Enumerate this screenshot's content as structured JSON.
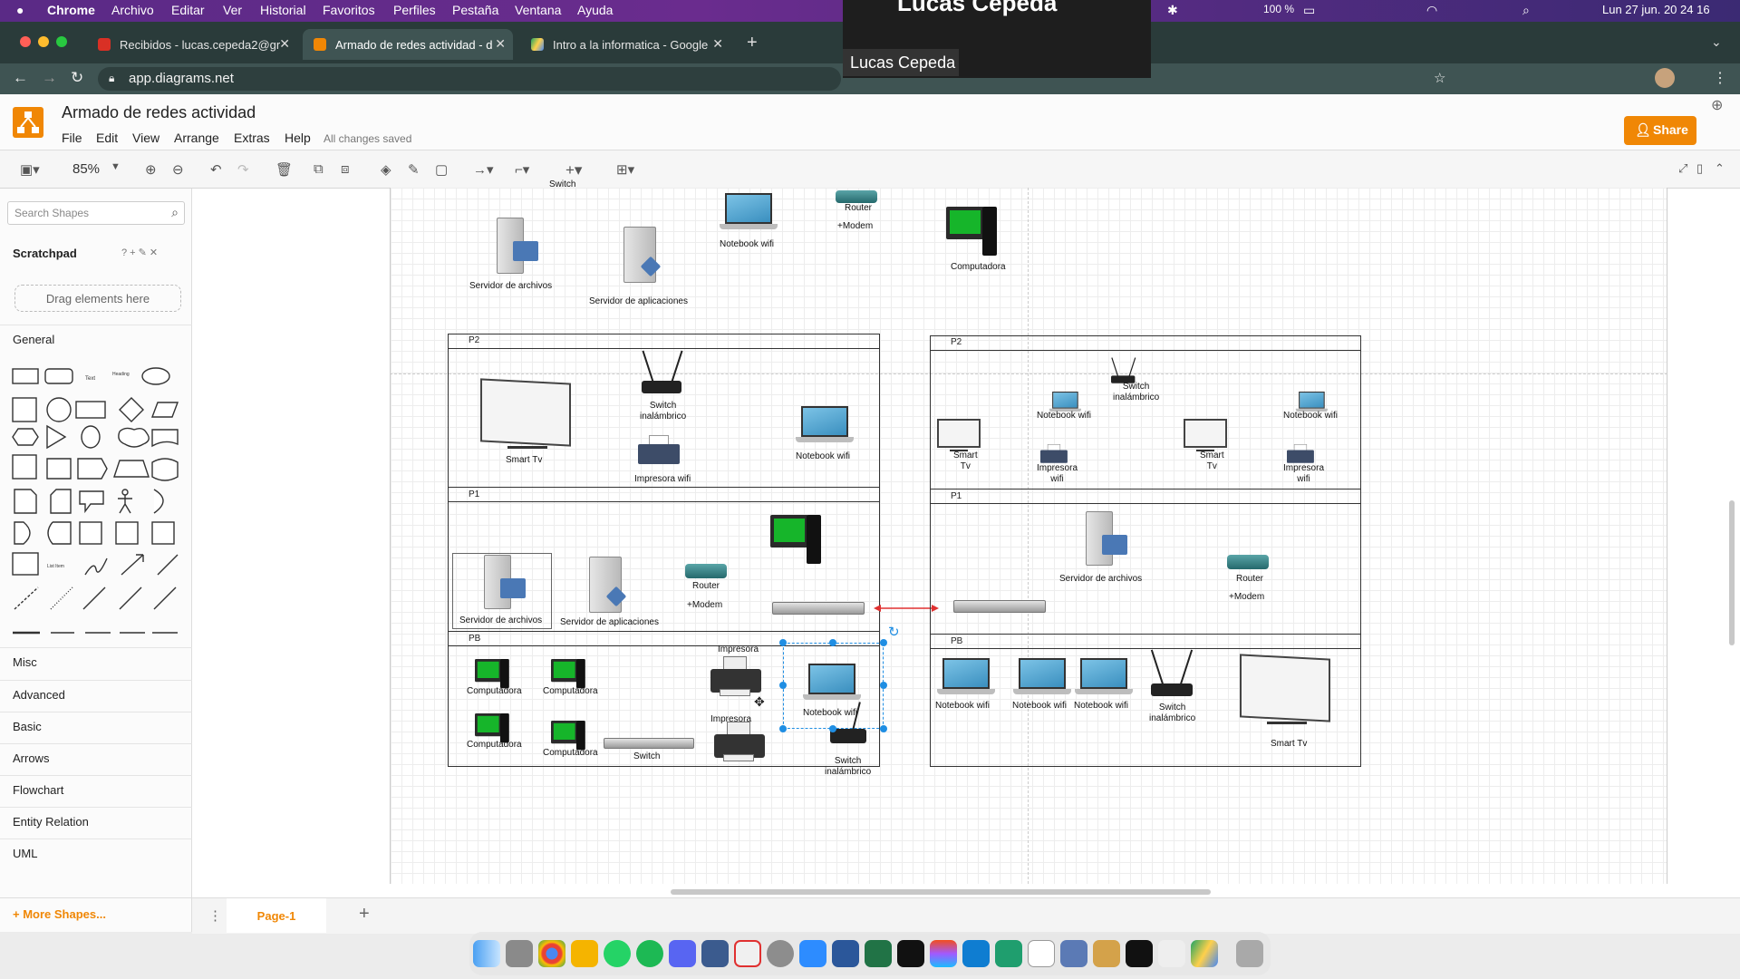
{
  "menubar": {
    "app": "Chrome",
    "items": [
      "Archivo",
      "Editar",
      "Ver",
      "Historial",
      "Favoritos",
      "Perfiles",
      "Pestaña",
      "Ventana",
      "Ayuda"
    ],
    "battery": "100 %",
    "datetime": "Lun 27 jun. 20 24 16"
  },
  "tabs": [
    {
      "title": "Recibidos - lucas.cepeda2@gr"
    },
    {
      "title": "Armado de redes actividad - d"
    },
    {
      "title": "Intro a la informatica - Google"
    }
  ],
  "address": {
    "url": "app.diagrams.net"
  },
  "video": {
    "name": "Lucas Cepeda",
    "top_text": "Lucas Cepeda"
  },
  "app": {
    "title": "Armado de redes actividad",
    "menus": [
      "File",
      "Edit",
      "View",
      "Arrange",
      "Extras",
      "Help"
    ],
    "status": "All changes saved",
    "share": "Share",
    "zoom": "85%"
  },
  "sidebar": {
    "search_placeholder": "Search Shapes",
    "scratchpad": "Scratchpad",
    "scratchpad_actions": "? + ✎ ✕",
    "drag_hint": "Drag elements here",
    "general": "General",
    "sections": [
      "Misc",
      "Advanced",
      "Basic",
      "Arrows",
      "Flowchart",
      "Entity Relation",
      "UML"
    ],
    "more_shapes": "+ More Shapes...",
    "shape_text": "Text",
    "shape_heading": "Heading",
    "shape_list_item": "List Item"
  },
  "pagebar": {
    "page": "Page-1"
  },
  "diagram": {
    "top_partial_switch": "Switch",
    "top_server_files": "Servidor de archivos",
    "top_server_apps": "Servidor de aplicaciones",
    "top_notebook": "Notebook wifi",
    "top_router": "Router",
    "top_modem": "+Modem",
    "top_computer": "Computadora",
    "left": {
      "p2": "P2",
      "p1": "P1",
      "pb": "PB",
      "smart_tv": "Smart Tv",
      "switch_wireless": "Switch\ninalámbrico",
      "printer_wifi": "Impresora wifi",
      "notebook_wifi": "Notebook wifi",
      "server_files": "Servidor de archivos",
      "server_apps": "Servidor de aplicaciones",
      "router": "Router",
      "modem": "+Modem",
      "computer": "Computadora",
      "printer": "Impresora",
      "switch": "Switch"
    },
    "right": {
      "p2": "P2",
      "p1": "P1",
      "pb": "PB",
      "notebook_wifi": "Notebook wifi",
      "switch_wireless": "Switch\ninalámbrico",
      "smart_tv": "Smart\nTv",
      "smart_tv_single": "Smart Tv",
      "printer_wifi": "Impresora\nwifi",
      "server_files": "Servidor de archivos",
      "router": "Router",
      "modem": "+Modem"
    }
  },
  "colors": {
    "menubar": "#5a2a86",
    "share": "#f08705",
    "selection": "#1f8ee3",
    "link_arrow": "#e03030",
    "screen_green": "#16b52a"
  }
}
